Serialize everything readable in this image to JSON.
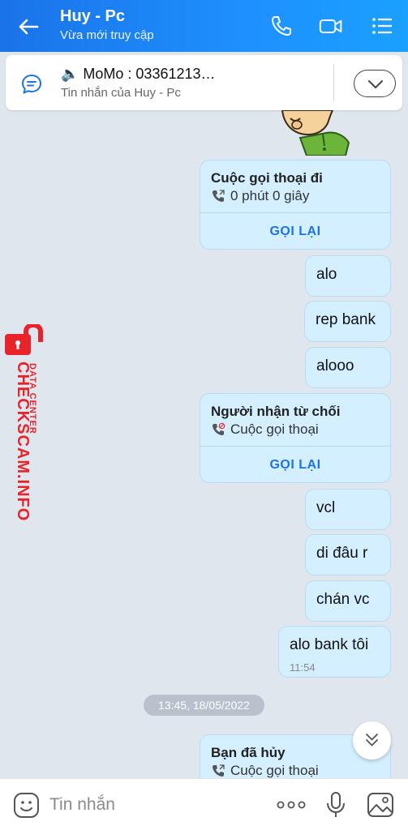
{
  "header": {
    "title": "Huy - Pc",
    "subtitle": "Vừa mới truy cập"
  },
  "pinned": {
    "title": "🔈 MoMo : 03361213…",
    "subtitle": "Tin nhắn của Huy - Pc"
  },
  "messages": [
    {
      "type": "call",
      "title": "Cuộc gọi thoại đi",
      "detail": "0 phút 0 giây",
      "action": "GỌI LẠI"
    },
    {
      "type": "text",
      "text": "alo"
    },
    {
      "type": "text",
      "text": "rep bank"
    },
    {
      "type": "text",
      "text": "alooo"
    },
    {
      "type": "call",
      "title": "Người nhận từ chối",
      "detail": "Cuộc gọi thoại",
      "action": "GỌI LẠI"
    },
    {
      "type": "text",
      "text": "vcl"
    },
    {
      "type": "text",
      "text": "di đâu r"
    },
    {
      "type": "text",
      "text": "chán vc"
    },
    {
      "type": "text",
      "text": "alo bank tôi",
      "time": "11:54"
    },
    {
      "type": "call",
      "title": "Bạn đã hủy",
      "detail": "Cuộc gọi thoại"
    }
  ],
  "date_separator": "13:45, 18/05/2022",
  "watermark": {
    "main": "CHECKSCAM.INFO",
    "sub": "DATA CENTER"
  },
  "input": {
    "placeholder": "Tin nhắn"
  },
  "colors": {
    "header_start": "#1a73e8",
    "bubble": "#d4efff",
    "action": "#1a73e8",
    "watermark": "#e8232a"
  }
}
